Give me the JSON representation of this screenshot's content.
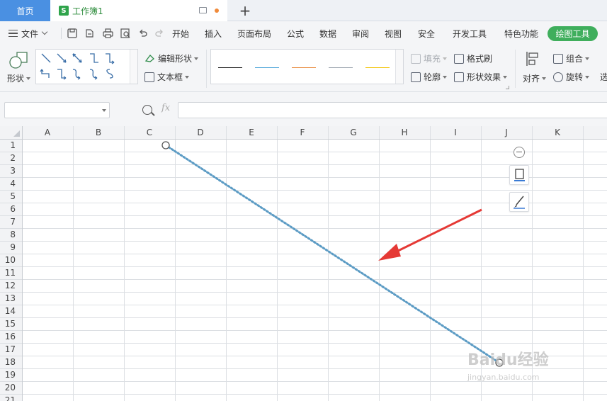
{
  "tabs": {
    "home_label": "首页",
    "doc_icon_letter": "S",
    "doc_label": "工作簿1",
    "new_tab_symbol": "+"
  },
  "menubar": {
    "file_label": "文件",
    "items": [
      "开始",
      "插入",
      "页面布局",
      "公式",
      "数据",
      "审阅",
      "视图",
      "安全",
      "开发工具",
      "特色功能"
    ],
    "active_tab": "绘图工具"
  },
  "ribbon": {
    "shape_label": "形状",
    "edit_shape_label": "编辑形状",
    "textbox_label": "文本框",
    "fill_label": "填充",
    "outline_label": "轮廓",
    "format_painter_label": "格式刷",
    "shape_effects_label": "形状效果",
    "align_label": "对齐",
    "group_label": "组合",
    "rotate_label": "旋转",
    "select_label": "选",
    "line_styles": [
      "#1a1a1a",
      "#4aa3d8",
      "#e8883a",
      "#9aa3ad",
      "#f2c200"
    ]
  },
  "formula": {
    "fx_label": "fx",
    "name_box_value": "",
    "formula_value": ""
  },
  "sheet": {
    "columns": [
      "A",
      "B",
      "C",
      "D",
      "E",
      "F",
      "G",
      "H",
      "I",
      "J",
      "K"
    ],
    "rows": [
      "1",
      "2",
      "3",
      "4",
      "5",
      "6",
      "7",
      "8",
      "9",
      "10",
      "11",
      "12",
      "13",
      "14",
      "15",
      "16",
      "17",
      "18",
      "19",
      "20",
      "21"
    ]
  },
  "colors": {
    "accent_blue": "#4a90e2",
    "accent_green": "#3fae5c",
    "line_color": "#5b9bc4",
    "arrow_red": "#e53935"
  },
  "watermark": {
    "brand": "Baidu经验",
    "url": "jingyan.baidu.com"
  }
}
